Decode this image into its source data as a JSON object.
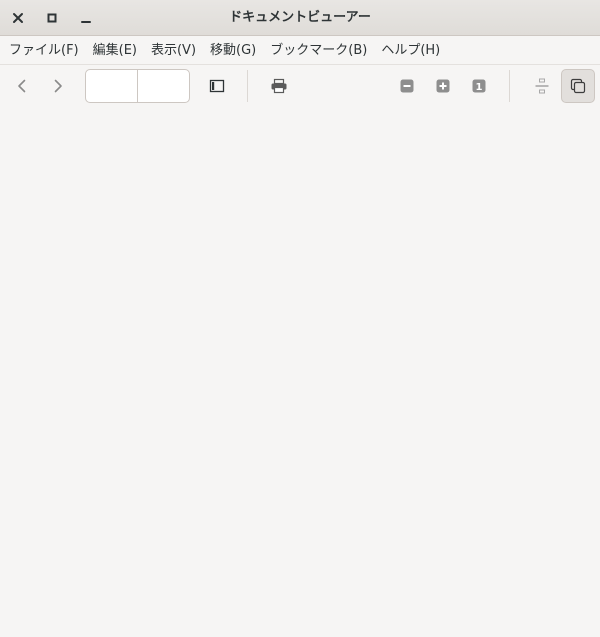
{
  "window": {
    "title": "ドキュメントビューアー",
    "controls": [
      "close-icon",
      "maximize-icon",
      "minimize-icon"
    ]
  },
  "menubar": {
    "items": [
      {
        "label": "ファイル(F)"
      },
      {
        "label": "編集(E)"
      },
      {
        "label": "表示(V)"
      },
      {
        "label": "移動(G)"
      },
      {
        "label": "ブックマーク(B)"
      },
      {
        "label": "ヘルプ(H)"
      }
    ]
  },
  "toolbar": {
    "page_entry": {
      "current_page": "",
      "total_pages": ""
    },
    "icons": [
      "go-previous-icon",
      "go-next-icon",
      "sidebar-toggle-icon",
      "print-icon",
      "zoom-out-icon",
      "zoom-in-icon",
      "zoom-original-icon",
      "continuous-view-icon",
      "dual-page-icon"
    ],
    "zoom_original_label": "1",
    "dual_page_pressed": true
  },
  "colors": {
    "background": "#f6f5f4",
    "titlebar": "#dfdcd8",
    "icon": "#3d3d3d",
    "icon_disabled": "#a8a8a8"
  }
}
